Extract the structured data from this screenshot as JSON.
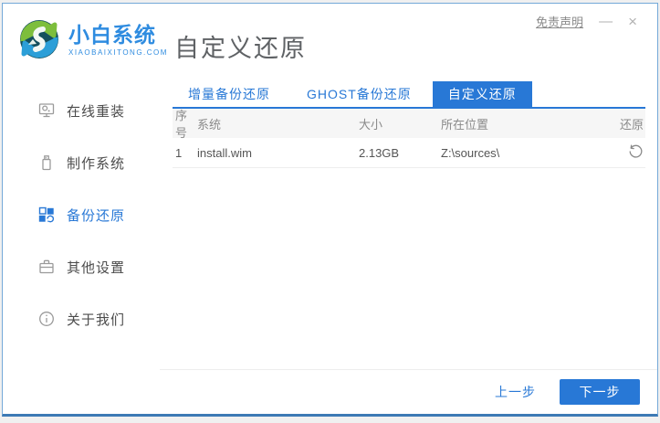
{
  "window": {
    "disclaimer": "免责声明",
    "minimize_glyph": "—",
    "close_glyph": "×"
  },
  "brand": {
    "name": "小白系统",
    "domain": "XIAOBAIXITONG.COM"
  },
  "page_title": "自定义还原",
  "sidebar": {
    "items": [
      {
        "label": "在线重装",
        "icon": "monitor-icon",
        "active": false
      },
      {
        "label": "制作系统",
        "icon": "usb-icon",
        "active": false
      },
      {
        "label": "备份还原",
        "icon": "backup-restore-icon",
        "active": true
      },
      {
        "label": "其他设置",
        "icon": "briefcase-icon",
        "active": false
      },
      {
        "label": "关于我们",
        "icon": "info-icon",
        "active": false
      }
    ]
  },
  "tabs": [
    {
      "label": "增量备份还原",
      "active": false
    },
    {
      "label": "GHOST备份还原",
      "active": false
    },
    {
      "label": "自定义还原",
      "active": true
    }
  ],
  "table": {
    "headers": [
      "序号",
      "系统",
      "大小",
      "所在位置",
      "还原"
    ],
    "rows": [
      {
        "no": "1",
        "system": "install.wim",
        "size": "2.13GB",
        "location": "Z:\\sources\\"
      }
    ]
  },
  "footer": {
    "prev_label": "上一步",
    "next_label": "下一步"
  },
  "colors": {
    "accent": "#2878d6",
    "brand_blue": "#2f8ce0",
    "border_blue": "#74a9d8"
  }
}
